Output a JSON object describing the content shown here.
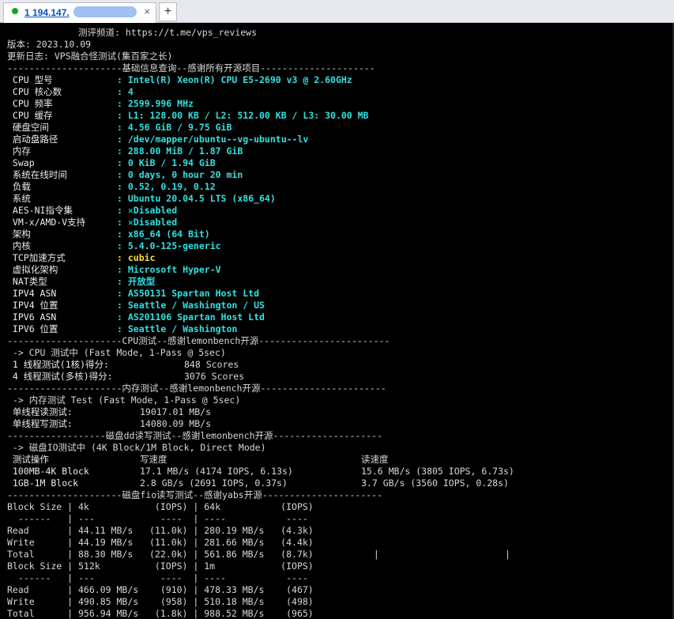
{
  "tab": {
    "title": "1 194.147.",
    "close_icon": "×",
    "add_icon": "+"
  },
  "terminal": {
    "lines": [
      "             测评频道: https://t.me/vps_reviews",
      "版本: 2023.10.09",
      "更新日志: VPS融合怪测试(集百家之长)",
      "---------------------基础信息查询--感谢所有开源项目---------------------",
      {
        "k": " CPU 型号",
        "v": ": Intel(R) Xeon(R) CPU E5-2690 v3 @ 2.60GHz",
        "cls": "cy"
      },
      {
        "k": " CPU 核心数",
        "v": ": 4",
        "cls": "cy"
      },
      {
        "k": " CPU 频率",
        "v": ": 2599.996 MHz",
        "cls": "cy"
      },
      {
        "k": " CPU 缓存",
        "v": ": L1: 128.00 KB / L2: 512.00 KB / L3: 30.00 MB",
        "cls": "cy"
      },
      {
        "k": " 硬盘空间",
        "v": ": 4.56 GiB / 9.75 GiB",
        "cls": "cy"
      },
      {
        "k": " 启动盘路径",
        "v": ": /dev/mapper/ubuntu--vg-ubuntu--lv",
        "cls": "cy"
      },
      {
        "k": " 内存",
        "v": ": 288.00 MiB / 1.87 GiB",
        "cls": "cy"
      },
      {
        "k": " Swap",
        "v": ": 0 KiB / 1.94 GiB",
        "cls": "cy"
      },
      {
        "k": " 系统在线时间",
        "v": ": 0 days, 0 hour 20 min",
        "cls": "cy"
      },
      {
        "k": " 负载",
        "v": ": 0.52, 0.19, 0.12",
        "cls": "cy"
      },
      {
        "k": " 系统",
        "v": ": Ubuntu 20.04.5 LTS (x86_64)",
        "cls": "cy"
      },
      {
        "k": " AES-NI指令集",
        "v": ": ✕Disabled",
        "cls": "cy"
      },
      {
        "k": " VM-x/AMD-V支持",
        "v": ": ✕Disabled",
        "cls": "cy"
      },
      {
        "k": " 架构",
        "v": ": x86_64 (64 Bit)",
        "cls": "cy"
      },
      {
        "k": " 内核",
        "v": ": 5.4.0-125-generic",
        "cls": "cy"
      },
      {
        "k": " TCP加速方式",
        "v": ": cubic",
        "cls": "yl"
      },
      {
        "k": " 虚拟化架构",
        "v": ": Microsoft Hyper-V",
        "cls": "cy"
      },
      {
        "k": " NAT类型",
        "v": ": 开放型",
        "cls": "cy"
      },
      {
        "k": " IPV4 ASN",
        "v": ": AS50131 Spartan Host Ltd",
        "cls": "cy"
      },
      {
        "k": " IPV4 位置",
        "v": ": Seattle / Washington / US",
        "cls": "cy"
      },
      {
        "k": " IPV6 ASN",
        "v": ": AS201106 Spartan Host Ltd",
        "cls": "cy"
      },
      {
        "k": " IPV6 位置",
        "v": ": Seattle / Washington",
        "cls": "cy"
      },
      "---------------------CPU测试--感谢lemonbench开源------------------------",
      " -> CPU 测试中 (Fast Mode, 1-Pass @ 5sec)",
      {
        "k": " 1 线程测试(1核)得分:",
        "v": "848 Scores",
        "vx": 224
      },
      {
        "k": " 4 线程测试(多核)得分:",
        "v": "3076 Scores",
        "vx": 224
      },
      "---------------------内存测试--感谢lemonbench开源-----------------------",
      " -> 内存测试 Test (Fast Mode, 1-Pass @ 5sec)",
      {
        "k": " 单线程读测试:",
        "v": "19017.01 MB/s",
        "vx": 168
      },
      {
        "k": " 单线程写测试:",
        "v": "14080.09 MB/s",
        "vx": 168
      },
      "------------------磁盘dd读写测试--感谢lemonbench开源--------------------",
      " -> 磁盘IO测试中 (4K Block/1M Block, Direct Mode)",
      {
        "k": " 测试操作",
        "v": "写速度",
        "v2": "读速度",
        "vx": 168,
        "v2x": 448
      },
      {
        "k": " 100MB-4K Block",
        "v": "17.1 MB/s (4174 IOPS, 6.13s)",
        "v2": "15.6 MB/s (3805 IOPS, 6.73s)",
        "vx": 168,
        "v2x": 448
      },
      {
        "k": " 1GB-1M Block",
        "v": "2.8 GB/s (2691 IOPS, 0.37s)",
        "v2": "3.7 GB/s (3560 IOPS, 0.28s)",
        "vx": 168,
        "v2x": 448
      },
      "---------------------磁盘fio读写测试--感谢yabs开源----------------------",
      "Block Size | 4k            (IOPS) | 64k           (IOPS)",
      "  ------   | ---            ----  | ----           ----",
      "Read       | 44.11 MB/s   (11.0k) | 280.19 MB/s   (4.3k)",
      "Write      | 44.19 MB/s   (11.0k) | 281.66 MB/s   (4.4k)",
      "Total      | 88.30 MB/s   (22.0k) | 561.86 MB/s   (8.7k)           |                       |",
      "Block Size | 512k          (IOPS) | 1m            (IOPS)",
      "  ------   | ---            ----  | ----           ----",
      "Read       | 466.09 MB/s    (910) | 478.33 MB/s    (467)",
      "Write      | 490.85 MB/s    (958) | 510.18 MB/s    (498)",
      "Total      | 956.94 MB/s   (1.8k) | 988.52 MB/s    (965)"
    ]
  }
}
